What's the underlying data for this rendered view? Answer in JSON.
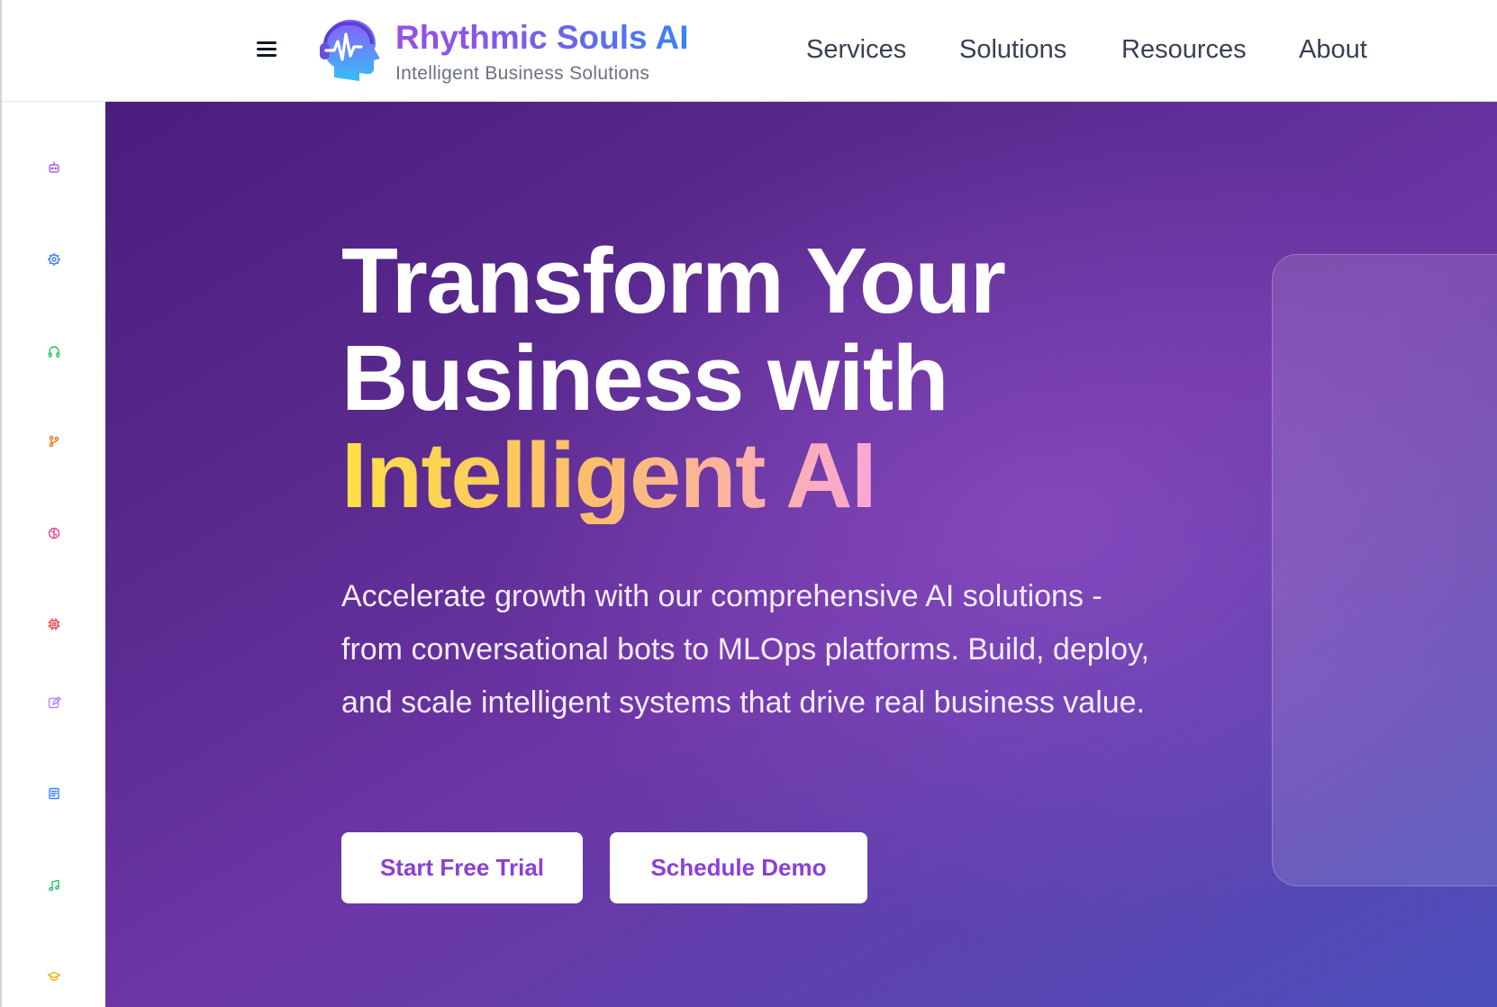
{
  "header": {
    "brand_name": "Rhythmic Souls AI",
    "brand_tagline": "Intelligent Business Solutions",
    "menu_icon": "hamburger-menu-icon",
    "logo_icon": "head-heartbeat-headphones-icon",
    "nav": [
      {
        "label": "Services"
      },
      {
        "label": "Solutions"
      },
      {
        "label": "Resources"
      },
      {
        "label": "About"
      }
    ]
  },
  "sidebar": {
    "icons": [
      {
        "name": "robot-icon",
        "color": "#a855f7"
      },
      {
        "name": "gear-icon",
        "color": "#3b82f6"
      },
      {
        "name": "headphones-icon",
        "color": "#22c55e"
      },
      {
        "name": "branch-icon",
        "color": "#f97316"
      },
      {
        "name": "brain-icon",
        "color": "#ec4899"
      },
      {
        "name": "cpu-chip-icon",
        "color": "#ef4444"
      },
      {
        "name": "edit-icon",
        "color": "#c084fc"
      },
      {
        "name": "newspaper-icon",
        "color": "#3b82f6"
      },
      {
        "name": "music-note-icon",
        "color": "#22c55e"
      },
      {
        "name": "graduation-cap-icon",
        "color": "#eab308"
      }
    ]
  },
  "hero": {
    "title_line1": "Transform Your",
    "title_line2": "Business with",
    "title_highlight": "Intelligent AI",
    "description": "Accelerate growth with our comprehensive AI solutions - from conversational bots to MLOps platforms. Build, deploy, and scale intelligent systems that drive real business value.",
    "primary_cta": "Start Free Trial",
    "secondary_cta": "Schedule Demo"
  },
  "colors": {
    "brand_gradient_start": "#9b4de6",
    "brand_gradient_end": "#3b82f6",
    "hero_background_start": "#4b1d7f",
    "hero_background_end": "#4a4fbc",
    "highlight_start": "#fde047",
    "highlight_end": "#f9a8d4",
    "button_text": "#8b3fd9"
  }
}
